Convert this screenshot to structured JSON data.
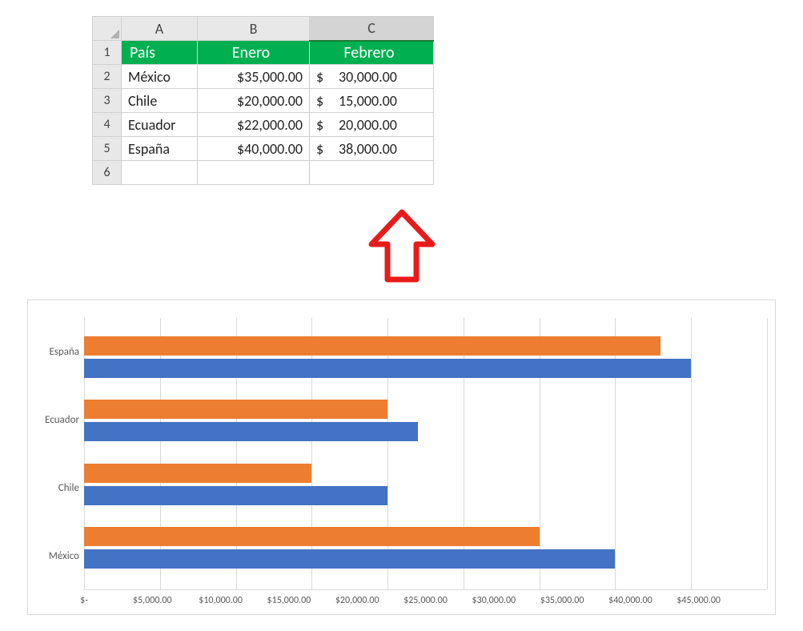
{
  "sheet": {
    "columns": [
      "A",
      "B",
      "C"
    ],
    "rows": [
      "1",
      "2",
      "3",
      "4",
      "5",
      "6"
    ],
    "headers": {
      "col1": "País",
      "col2": "Enero",
      "col3": "Febrero"
    },
    "data": [
      {
        "pais": "México",
        "enero": "$35,000.00",
        "febrero": "30,000.00"
      },
      {
        "pais": "Chile",
        "enero": "$20,000.00",
        "febrero": "15,000.00"
      },
      {
        "pais": "Ecuador",
        "enero": "$22,000.00",
        "febrero": "20,000.00"
      },
      {
        "pais": "España",
        "enero": "$40,000.00",
        "febrero": "38,000.00"
      }
    ],
    "currency_symbol": "$"
  },
  "chart_data": {
    "type": "bar",
    "orientation": "horizontal",
    "categories": [
      "España",
      "Ecuador",
      "Chile",
      "México"
    ],
    "series": [
      {
        "name": "Febrero",
        "color": "#ed7d31",
        "values": [
          38000,
          20000,
          15000,
          30000
        ]
      },
      {
        "name": "Enero",
        "color": "#4472c4",
        "values": [
          40000,
          22000,
          20000,
          35000
        ]
      }
    ],
    "xlim": [
      0,
      45000
    ],
    "xticks": [
      "$-",
      "$5,000.00",
      "$10,000.00",
      "$15,000.00",
      "$20,000.00",
      "$25,000.00",
      "$30,000.00",
      "$35,000.00",
      "$40,000.00",
      "$45,000.00"
    ],
    "title": "",
    "xlabel": "",
    "ylabel": "",
    "grid": true
  },
  "arrow_color": "#e81b1b"
}
